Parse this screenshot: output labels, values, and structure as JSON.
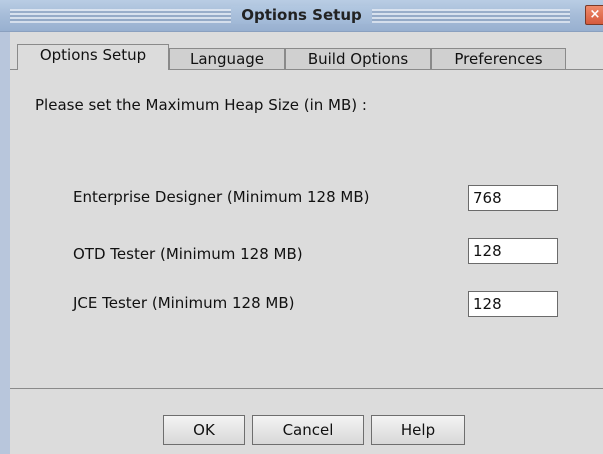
{
  "window": {
    "title": "Options Setup",
    "close_label": "×"
  },
  "tabs": [
    {
      "label": "Options Setup",
      "active": true
    },
    {
      "label": "Language",
      "active": false
    },
    {
      "label": "Build Options",
      "active": false
    },
    {
      "label": "Preferences",
      "active": false
    }
  ],
  "panel": {
    "prompt": "Please set the Maximum Heap Size (in MB) :",
    "rows": [
      {
        "label": "Enterprise Designer (Minimum 128 MB)",
        "value": "768"
      },
      {
        "label": "OTD Tester (Minimum 128 MB)",
        "value": "128"
      },
      {
        "label": "JCE Tester (Minimum 128 MB)",
        "value": "128"
      }
    ]
  },
  "buttons": {
    "ok": "OK",
    "cancel": "Cancel",
    "help": "Help"
  },
  "colors": {
    "titlebar": "#a6bcd8",
    "window_bg": "#dcdcdc",
    "close_button": "#d55a3d"
  }
}
